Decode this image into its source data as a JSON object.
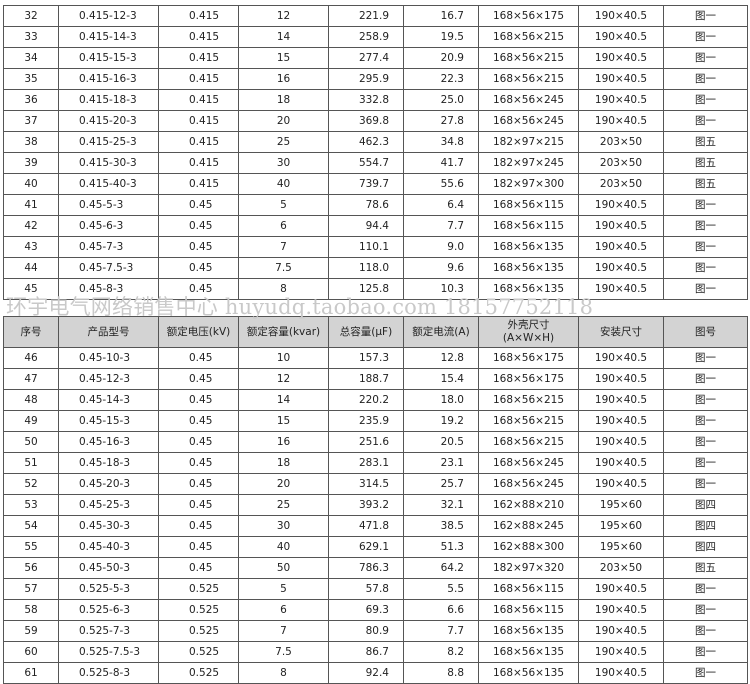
{
  "watermark": "环宇电气网络销售中心 huyudq.taobao.com 18157752118",
  "headers": [
    "序号",
    "产品型号",
    "额定电压(kV)",
    "额定容量(kvar)",
    "总容量(μF)",
    "额定电流(A)",
    "外壳尺寸\n(A×W×H)",
    "安装尺寸",
    "图号"
  ],
  "top_rows": [
    [
      "32",
      "0.415-12-3",
      "0.415",
      "12",
      "221.9",
      "16.7",
      "168×56×175",
      "190×40.5",
      "图一"
    ],
    [
      "33",
      "0.415-14-3",
      "0.415",
      "14",
      "258.9",
      "19.5",
      "168×56×215",
      "190×40.5",
      "图一"
    ],
    [
      "34",
      "0.415-15-3",
      "0.415",
      "15",
      "277.4",
      "20.9",
      "168×56×215",
      "190×40.5",
      "图一"
    ],
    [
      "35",
      "0.415-16-3",
      "0.415",
      "16",
      "295.9",
      "22.3",
      "168×56×215",
      "190×40.5",
      "图一"
    ],
    [
      "36",
      "0.415-18-3",
      "0.415",
      "18",
      "332.8",
      "25.0",
      "168×56×245",
      "190×40.5",
      "图一"
    ],
    [
      "37",
      "0.415-20-3",
      "0.415",
      "20",
      "369.8",
      "27.8",
      "168×56×245",
      "190×40.5",
      "图一"
    ],
    [
      "38",
      "0.415-25-3",
      "0.415",
      "25",
      "462.3",
      "34.8",
      "182×97×215",
      "203×50",
      "图五"
    ],
    [
      "39",
      "0.415-30-3",
      "0.415",
      "30",
      "554.7",
      "41.7",
      "182×97×245",
      "203×50",
      "图五"
    ],
    [
      "40",
      "0.415-40-3",
      "0.415",
      "40",
      "739.7",
      "55.6",
      "182×97×300",
      "203×50",
      "图五"
    ],
    [
      "41",
      "0.45-5-3",
      "0.45",
      "5",
      "78.6",
      "6.4",
      "168×56×115",
      "190×40.5",
      "图一"
    ],
    [
      "42",
      "0.45-6-3",
      "0.45",
      "6",
      "94.4",
      "7.7",
      "168×56×115",
      "190×40.5",
      "图一"
    ],
    [
      "43",
      "0.45-7-3",
      "0.45",
      "7",
      "110.1",
      "9.0",
      "168×56×135",
      "190×40.5",
      "图一"
    ],
    [
      "44",
      "0.45-7.5-3",
      "0.45",
      "7.5",
      "118.0",
      "9.6",
      "168×56×135",
      "190×40.5",
      "图一"
    ],
    [
      "45",
      "0.45-8-3",
      "0.45",
      "8",
      "125.8",
      "10.3",
      "168×56×135",
      "190×40.5",
      "图一"
    ]
  ],
  "bottom_rows": [
    [
      "46",
      "0.45-10-3",
      "0.45",
      "10",
      "157.3",
      "12.8",
      "168×56×175",
      "190×40.5",
      "图一"
    ],
    [
      "47",
      "0.45-12-3",
      "0.45",
      "12",
      "188.7",
      "15.4",
      "168×56×175",
      "190×40.5",
      "图一"
    ],
    [
      "48",
      "0.45-14-3",
      "0.45",
      "14",
      "220.2",
      "18.0",
      "168×56×215",
      "190×40.5",
      "图一"
    ],
    [
      "49",
      "0.45-15-3",
      "0.45",
      "15",
      "235.9",
      "19.2",
      "168×56×215",
      "190×40.5",
      "图一"
    ],
    [
      "50",
      "0.45-16-3",
      "0.45",
      "16",
      "251.6",
      "20.5",
      "168×56×215",
      "190×40.5",
      "图一"
    ],
    [
      "51",
      "0.45-18-3",
      "0.45",
      "18",
      "283.1",
      "23.1",
      "168×56×245",
      "190×40.5",
      "图一"
    ],
    [
      "52",
      "0.45-20-3",
      "0.45",
      "20",
      "314.5",
      "25.7",
      "168×56×245",
      "190×40.5",
      "图一"
    ],
    [
      "53",
      "0.45-25-3",
      "0.45",
      "25",
      "393.2",
      "32.1",
      "162×88×210",
      "195×60",
      "图四"
    ],
    [
      "54",
      "0.45-30-3",
      "0.45",
      "30",
      "471.8",
      "38.5",
      "162×88×245",
      "195×60",
      "图四"
    ],
    [
      "55",
      "0.45-40-3",
      "0.45",
      "40",
      "629.1",
      "51.3",
      "162×88×300",
      "195×60",
      "图四"
    ],
    [
      "56",
      "0.45-50-3",
      "0.45",
      "50",
      "786.3",
      "64.2",
      "182×97×320",
      "203×50",
      "图五"
    ],
    [
      "57",
      "0.525-5-3",
      "0.525",
      "5",
      "57.8",
      "5.5",
      "168×56×115",
      "190×40.5",
      "图一"
    ],
    [
      "58",
      "0.525-6-3",
      "0.525",
      "6",
      "69.3",
      "6.6",
      "168×56×115",
      "190×40.5",
      "图一"
    ],
    [
      "59",
      "0.525-7-3",
      "0.525",
      "7",
      "80.9",
      "7.7",
      "168×56×135",
      "190×40.5",
      "图一"
    ],
    [
      "60",
      "0.525-7.5-3",
      "0.525",
      "7.5",
      "86.7",
      "8.2",
      "168×56×135",
      "190×40.5",
      "图一"
    ],
    [
      "61",
      "0.525-8-3",
      "0.525",
      "8",
      "92.4",
      "8.8",
      "168×56×135",
      "190×40.5",
      "图一"
    ]
  ]
}
